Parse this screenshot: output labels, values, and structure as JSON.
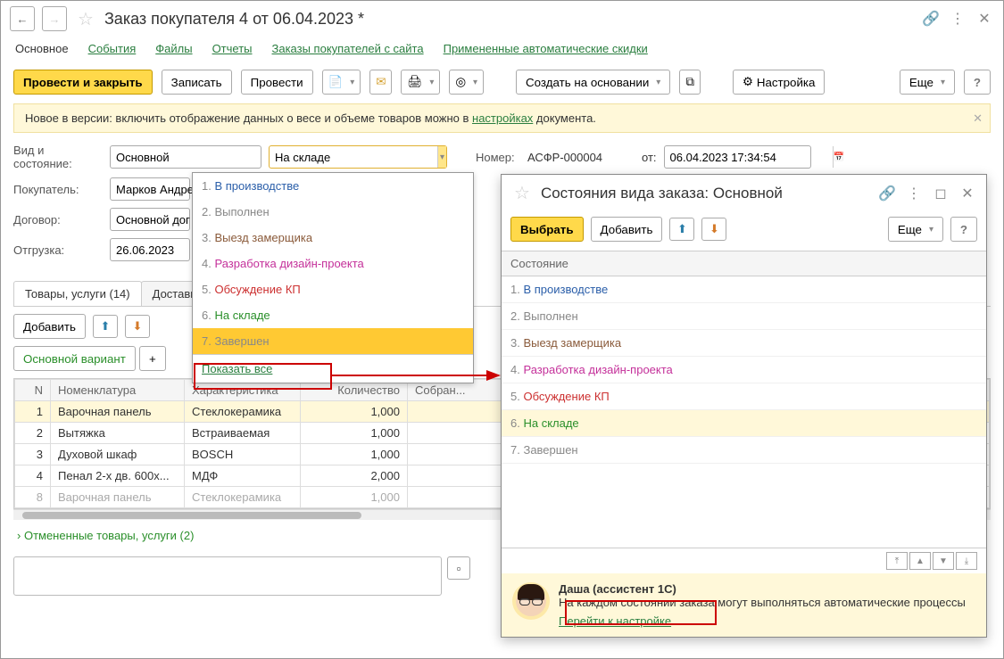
{
  "header": {
    "title": "Заказ покупателя 4 от 06.04.2023 *"
  },
  "nav_tabs": {
    "main": "Основное",
    "events": "События",
    "files": "Файлы",
    "reports": "Отчеты",
    "site_orders": "Заказы покупателей с сайта",
    "discounts": "Примененные автоматические скидки"
  },
  "toolbar": {
    "post_and_close": "Провести и закрыть",
    "save": "Записать",
    "post": "Провести",
    "create_based": "Создать на основании",
    "settings": "Настройка",
    "more": "Еще",
    "help": "?"
  },
  "banner": {
    "text_before": "Новое в версии: включить отображение данных о весе и объеме товаров можно в ",
    "link": "настройках",
    "text_after": " документа."
  },
  "form": {
    "kind_label": "Вид и состояние:",
    "kind_value": "Основной",
    "status_value": "На складе",
    "number_label": "Номер:",
    "number_value": "АСФР-000004",
    "from_label": "от:",
    "date_value": "06.04.2023 17:34:54",
    "buyer_label": "Покупатель:",
    "buyer_value": "Марков Андре",
    "contract_label": "Договор:",
    "contract_value": "Основной дог",
    "ship_label": "Отгрузка:",
    "ship_value": "26.06.2023"
  },
  "dropdown": {
    "items": [
      {
        "num": "1.",
        "text": "В производстве",
        "cls": "c-blue"
      },
      {
        "num": "2.",
        "text": "Выполнен",
        "cls": "c-gray"
      },
      {
        "num": "3.",
        "text": "Выезд замерщика",
        "cls": "c-brown"
      },
      {
        "num": "4.",
        "text": "Разработка дизайн-проекта",
        "cls": "c-magenta"
      },
      {
        "num": "5.",
        "text": "Обсуждение КП",
        "cls": "c-red"
      },
      {
        "num": "6.",
        "text": "На складе",
        "cls": "c-green"
      },
      {
        "num": "7.",
        "text": "Завершен",
        "cls": "c-gray"
      }
    ],
    "show_all": "Показать все"
  },
  "content_tabs": {
    "goods": "Товары, услуги (14)",
    "delivery": "Доставка"
  },
  "table_toolbar": {
    "add": "Добавить",
    "main_variant": "Основной вариант",
    "plus": "+"
  },
  "table": {
    "cols": [
      "N",
      "Номенклатура",
      "Характеристика",
      "Количество",
      "Собран..."
    ],
    "rows": [
      {
        "n": "1",
        "name": "Варочная панель",
        "char": "Стеклокерамика",
        "qty": "1,000",
        "selected": true
      },
      {
        "n": "2",
        "name": "Вытяжка",
        "char": "Встраиваемая",
        "qty": "1,000"
      },
      {
        "n": "3",
        "name": "Духовой шкаф",
        "char": "BOSCH",
        "qty": "1,000"
      },
      {
        "n": "4",
        "name": "Пенал 2-х дв. 600х...",
        "char": "МДФ",
        "qty": "2,000"
      },
      {
        "n": "8",
        "name": "Варочная панель",
        "char": "Стеклокерамика",
        "qty": "1,000",
        "strike": true
      }
    ]
  },
  "footer": {
    "cancelled": "Отмененные товары, услуги (2)"
  },
  "modal": {
    "title": "Состояния вида заказа: Основной",
    "select": "Выбрать",
    "add": "Добавить",
    "more": "Еще",
    "help": "?",
    "col_header": "Состояние",
    "items": [
      {
        "num": "1.",
        "text": "В производстве",
        "cls": "c-blue"
      },
      {
        "num": "2.",
        "text": "Выполнен",
        "cls": "c-gray"
      },
      {
        "num": "3.",
        "text": "Выезд замерщика",
        "cls": "c-brown"
      },
      {
        "num": "4.",
        "text": "Разработка дизайн-проекта",
        "cls": "c-magenta"
      },
      {
        "num": "5.",
        "text": "Обсуждение КП",
        "cls": "c-red"
      },
      {
        "num": "6.",
        "text": "На складе",
        "cls": "c-green",
        "selected": true
      },
      {
        "num": "7.",
        "text": "Завершен",
        "cls": "c-gray"
      }
    ],
    "assistant": {
      "name": "Даша (ассистент 1С)",
      "text": "На каждом состоянии заказа могут выполняться автоматические процессы",
      "link": "Перейти к настройке"
    }
  }
}
